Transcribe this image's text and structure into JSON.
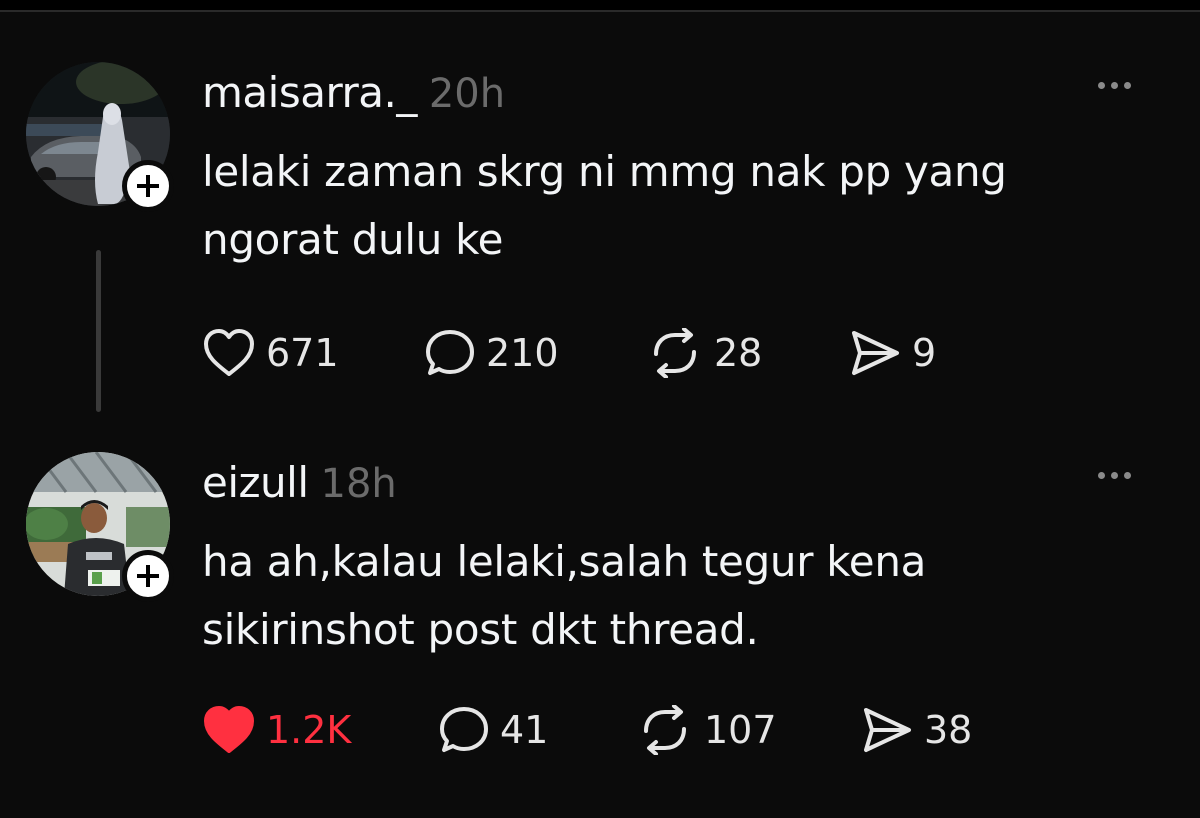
{
  "colors": {
    "background": "#0b0b0b",
    "text": "#f3f5f7",
    "muted": "#6b6b6b",
    "like_active": "#ff3040"
  },
  "posts": [
    {
      "username": "maisarra._",
      "time": "20h",
      "text_lines": [
        "lelaki zaman skrg ni mmg nak pp yang",
        "ngorat dulu ke"
      ],
      "likes": "671",
      "replies": "210",
      "reposts": "28",
      "shares": "9",
      "liked": false,
      "icons": {
        "like": "heart-outline-icon",
        "reply": "comment-icon",
        "repost": "repost-icon",
        "share": "send-icon",
        "more": "more-horizontal-icon"
      }
    },
    {
      "username": "eizull",
      "time": "18h",
      "text_lines": [
        "ha ah,kalau lelaki,salah tegur kena",
        "sikirinshot post dkt thread."
      ],
      "likes": "1.2K",
      "replies": "41",
      "reposts": "107",
      "shares": "38",
      "liked": true,
      "icons": {
        "like": "heart-filled-icon",
        "reply": "comment-icon",
        "repost": "repost-icon",
        "share": "send-icon",
        "more": "more-horizontal-icon"
      }
    }
  ]
}
